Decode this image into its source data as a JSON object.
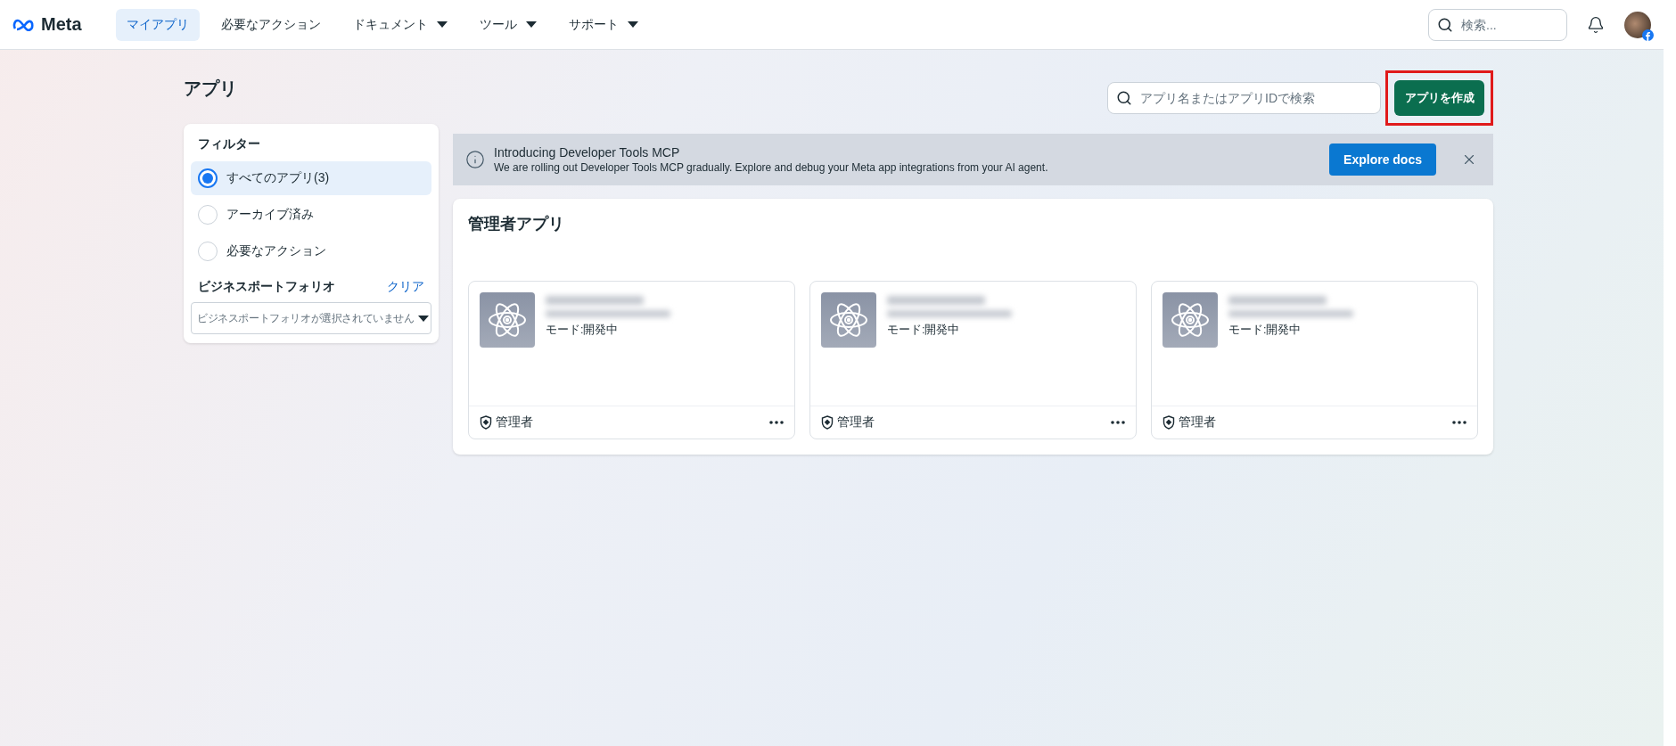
{
  "nav": {
    "logo": "Meta",
    "items": [
      {
        "label": "マイアプリ",
        "selected": true,
        "dropdown": false
      },
      {
        "label": "必要なアクション",
        "selected": false,
        "dropdown": false
      },
      {
        "label": "ドキュメント",
        "selected": false,
        "dropdown": true
      },
      {
        "label": "ツール",
        "selected": false,
        "dropdown": true
      },
      {
        "label": "サポート",
        "selected": false,
        "dropdown": true
      }
    ],
    "search_placeholder": "検索..."
  },
  "page": {
    "title": "アプリ",
    "search_placeholder": "アプリ名またはアプリIDで検索",
    "create_button": "アプリを作成",
    "create_highlighted": true
  },
  "filter": {
    "title": "フィルター",
    "options": [
      {
        "label": "すべてのアプリ(3)",
        "selected": true
      },
      {
        "label": "アーカイブ済み",
        "selected": false
      },
      {
        "label": "必要なアクション",
        "selected": false
      }
    ],
    "portfolio_label": "ビジネスポートフォリオ",
    "clear": "クリア",
    "portfolio_placeholder": "ビジネスポートフォリオが選択されていません"
  },
  "banner": {
    "title": "Introducing Developer Tools MCP",
    "text": "We are rolling out Developer Tools MCP gradually. Explore and debug your Meta app integrations from your AI agent.",
    "button": "Explore docs"
  },
  "apps_section": {
    "title": "管理者アプリ",
    "apps": [
      {
        "mode": "モード:開発中",
        "role": "管理者"
      },
      {
        "mode": "モード:開発中",
        "role": "管理者"
      },
      {
        "mode": "モード:開発中",
        "role": "管理者"
      }
    ]
  }
}
